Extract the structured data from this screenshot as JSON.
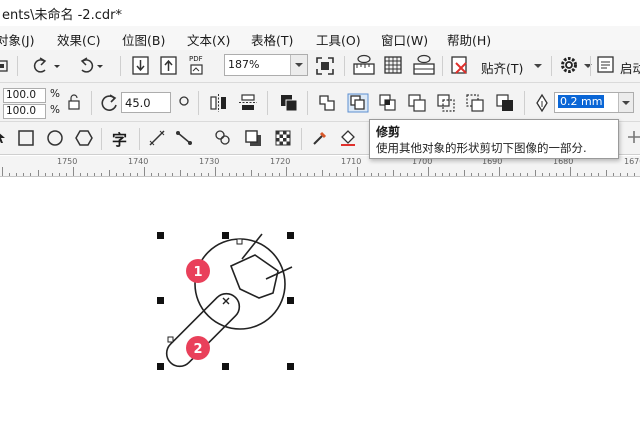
{
  "window": {
    "title": "ents\\未命名 -2.cdr*"
  },
  "menu": {
    "items": [
      {
        "label": "对象(J)"
      },
      {
        "label": "效果(C)"
      },
      {
        "label": "位图(B)"
      },
      {
        "label": "文本(X)"
      },
      {
        "label": "表格(T)"
      },
      {
        "label": "工具(O)"
      },
      {
        "label": "窗口(W)"
      },
      {
        "label": "帮助(H)"
      }
    ]
  },
  "toolbar": {
    "zoom_value": "187%",
    "snap_label": "贴齐(T)",
    "launch_label": "启动",
    "pdf_label": "PDF"
  },
  "properties": {
    "scale_x": "100.0",
    "scale_y": "100.0",
    "percent_symbol": "%",
    "angle": "45.0",
    "outline_width": "0.2 mm"
  },
  "toolbox": {
    "text_tool_label": "字"
  },
  "tooltip": {
    "title": "修剪",
    "description": "使用其他对象的形状剪切下图像的一部分."
  },
  "ruler": {
    "labels": [
      "1750",
      "1740",
      "1730",
      "1720",
      "1710",
      "1700",
      "1690",
      "1680",
      "1670"
    ]
  },
  "canvas": {
    "markers": [
      {
        "label": "1"
      },
      {
        "label": "2"
      }
    ]
  },
  "colors": {
    "accent_red": "#e0302c",
    "marker_pink": "#e9405a",
    "selection_blue": "#0a66d6"
  }
}
